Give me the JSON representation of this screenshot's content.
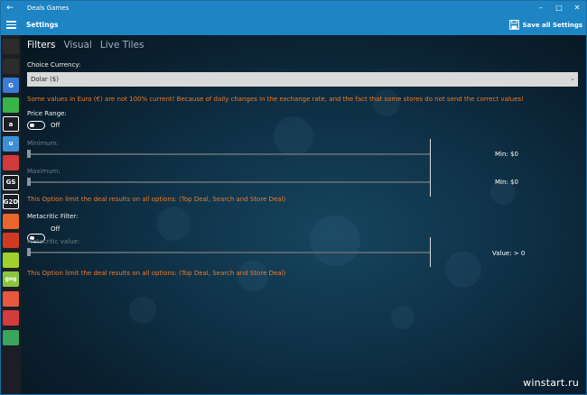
{
  "app": {
    "window_title": "Deals Games",
    "page_title": "Settings",
    "save_all_label": "Save all Settings"
  },
  "sidebar": {
    "icons": [
      {
        "name": "store-icon-1",
        "text": "",
        "color": "#2c2c2c"
      },
      {
        "name": "store-icon-2",
        "text": "",
        "color": "#2c2c2c"
      },
      {
        "name": "store-icon-3",
        "text": "G",
        "color": "#3a7bd5"
      },
      {
        "name": "store-icon-4",
        "text": "",
        "color": "#38b54a"
      },
      {
        "name": "amazon-icon",
        "text": "a",
        "color": "#1b1f25"
      },
      {
        "name": "store-icon-6",
        "text": "u",
        "color": "#3d8fd6"
      },
      {
        "name": "store-icon-7",
        "text": "",
        "color": "#d03a3a"
      },
      {
        "name": "store-icon-8",
        "text": "GS",
        "color": "#1b1f25"
      },
      {
        "name": "store-icon-9",
        "text": "G2D",
        "color": "#1b1f25"
      },
      {
        "name": "store-icon-10",
        "text": "",
        "color": "#e8652c"
      },
      {
        "name": "store-icon-11",
        "text": "",
        "color": "#d13a22"
      },
      {
        "name": "store-icon-12",
        "text": "",
        "color": "#9fd02b"
      },
      {
        "name": "gog-icon",
        "text": "gog",
        "color": "#8bc53f"
      },
      {
        "name": "store-icon-14",
        "text": "",
        "color": "#e9573f"
      },
      {
        "name": "store-icon-15",
        "text": "",
        "color": "#d23c3c"
      },
      {
        "name": "store-icon-16",
        "text": "",
        "color": "#3aa55d"
      },
      {
        "name": "store-icon-17",
        "text": "",
        "color": "#1b1f25"
      },
      {
        "name": "store-icon-18",
        "text": "",
        "color": "#1b1f25"
      }
    ]
  },
  "tabs": [
    {
      "label": "Filters",
      "active": true
    },
    {
      "label": "Visual",
      "active": false
    },
    {
      "label": "Live Tiles",
      "active": false
    }
  ],
  "currency": {
    "label": "Choice Currency:",
    "selected": "Dolar ($)",
    "warning": "Some values in Euro (€) are not 100% current! Because of daily changes in the exchange rate, and the fact that some stores do not send the correct values!"
  },
  "price_range": {
    "label": "Price Range:",
    "toggle_state": "Off",
    "minimum_label": "Minimum:",
    "minimum_value": "Min: $0",
    "maximum_label": "Maximum:",
    "maximum_value": "Min: $0",
    "note": "This Option limit the deal results on all options: (Top Deal, Search and Store Deal)"
  },
  "metacritic": {
    "label": "Metacritic Filter:",
    "toggle_state": "Off",
    "value_label": "Metacritic value:",
    "value": "Value: > 0",
    "note": "This Option limit the deal results on all options: (Top Deal, Search and Store Deal)"
  },
  "watermark": "winstart.ru",
  "colors": {
    "accent": "#1e84c4",
    "warning": "#f07a28",
    "sidebar": "#1b1f25"
  }
}
